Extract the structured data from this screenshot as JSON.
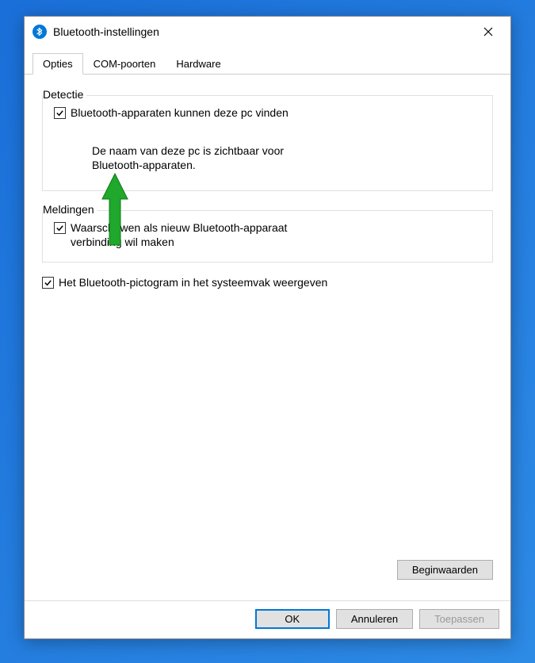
{
  "window": {
    "title": "Bluetooth-instellingen"
  },
  "tabs": {
    "options": "Opties",
    "com": "COM-poorten",
    "hardware": "Hardware"
  },
  "detection": {
    "legend": "Detectie",
    "checkbox_label": "Bluetooth-apparaten kunnen deze pc vinden",
    "description": "De naam van deze pc is zichtbaar voor Bluetooth-apparaten."
  },
  "notifications": {
    "legend": "Meldingen",
    "checkbox_label": "Waarschuwen als nieuw Bluetooth-apparaat verbinding wil maken"
  },
  "systray": {
    "checkbox_label": "Het Bluetooth-pictogram in het systeemvak weergeven"
  },
  "buttons": {
    "reset": "Beginwaarden",
    "ok": "OK",
    "cancel": "Annuleren",
    "apply": "Toepassen"
  }
}
